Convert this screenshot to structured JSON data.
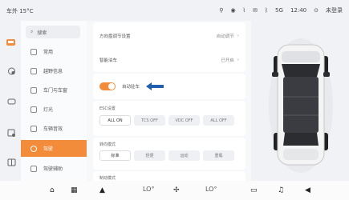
{
  "status": {
    "outside_temp": "车外 15°C",
    "time": "12:40",
    "login": "未登录",
    "signal": "5G"
  },
  "menu": {
    "search": "搜索",
    "items": [
      {
        "label": "常用",
        "icon": "star-icon"
      },
      {
        "label": "越野信息",
        "icon": "offroad-icon"
      },
      {
        "label": "车门与车窗",
        "icon": "door-icon"
      },
      {
        "label": "灯光",
        "icon": "light-icon"
      },
      {
        "label": "车辆音效",
        "icon": "sound-icon"
      },
      {
        "label": "驾驶",
        "icon": "steering-icon",
        "active": true
      },
      {
        "label": "驾驶辅助",
        "icon": "assist-icon"
      }
    ]
  },
  "panel": {
    "row1_label": "方向盘调节设置",
    "row1_value": "自动调节",
    "row2_label": "智能泊车",
    "row2_value": "已开启",
    "toggle_label": "自动驻车",
    "esc": {
      "label": "ESC设置",
      "options": [
        "ALL ON",
        "TCS OFF",
        "VDC OFF",
        "ALL OFF"
      ],
      "selected": 0
    },
    "steering": {
      "label": "转向模式",
      "options": [
        "标准",
        "轻便",
        "运动",
        "重载"
      ],
      "selected": 0
    },
    "brake_label": "制动模式"
  },
  "dock": {
    "lo_left": "LO°",
    "lo_right": "LO°"
  },
  "colors": {
    "accent": "#f28c3a",
    "arrow": "#1f5fae"
  }
}
